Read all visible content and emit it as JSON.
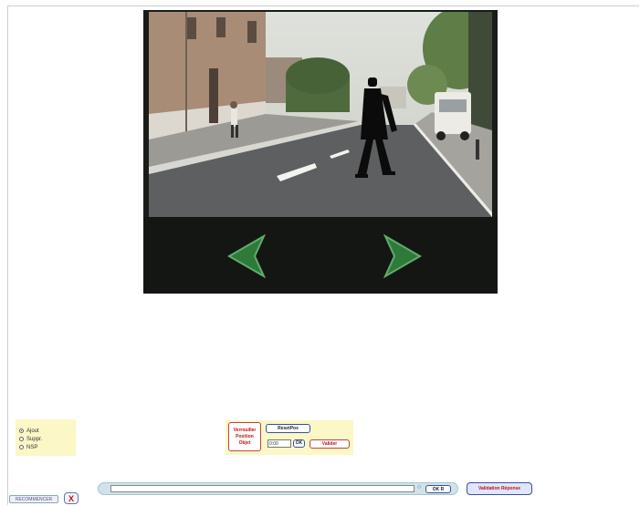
{
  "icons": {
    "prev": "arrow-left-icon",
    "next": "arrow-right-icon",
    "close": "close-x-icon"
  },
  "mode_panel": {
    "options": [
      {
        "label": "Ajout",
        "checked": true
      },
      {
        "label": "Suppr.",
        "checked": false
      },
      {
        "label": "NSP",
        "checked": false
      }
    ]
  },
  "control_panel": {
    "lock_lines": [
      "Verrouiller",
      "Position",
      "Objet"
    ],
    "reset_label": "ResetPos",
    "time_value": "0:00",
    "ok_label": "OK",
    "validate_label": "Valider"
  },
  "bottom_bar": {
    "restart_label": "RECOMMENCER",
    "close_symbol": "X",
    "field_value": "",
    "field_cap": "○",
    "ok_label": "OK R",
    "answer_label": "Validation Réponse"
  },
  "colors": {
    "panel_bg": "#fbf7c6",
    "arrow_green": "#2f7a3a",
    "accent_red": "#c01010",
    "button_border": "#3b4fa0"
  }
}
